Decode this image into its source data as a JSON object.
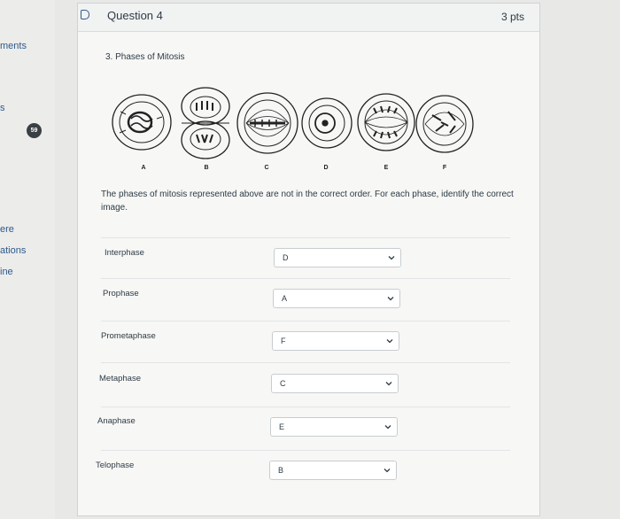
{
  "sidebar": {
    "items": [
      "ments",
      "s",
      "ere",
      "ations",
      "ine"
    ],
    "badge": "59"
  },
  "question": {
    "title": "Question 4",
    "points": "3 pts",
    "subtitle": "3. Phases of Mitosis",
    "figure_labels": [
      "A",
      "B",
      "C",
      "D",
      "E",
      "F"
    ],
    "instructions": "The phases of mitosis represented above are not in the correct order. For each phase, identify the correct image."
  },
  "matches": [
    {
      "label": "Interphase",
      "value": "D"
    },
    {
      "label": "Prophase",
      "value": "A"
    },
    {
      "label": "Prometaphase",
      "value": "F"
    },
    {
      "label": "Metaphase",
      "value": "C"
    },
    {
      "label": "Anaphase",
      "value": "E"
    },
    {
      "label": "Telophase",
      "value": "B"
    }
  ],
  "colors": {
    "link": "#2d5a8c",
    "text": "#2d3b45",
    "border": "#c7cdd1"
  }
}
